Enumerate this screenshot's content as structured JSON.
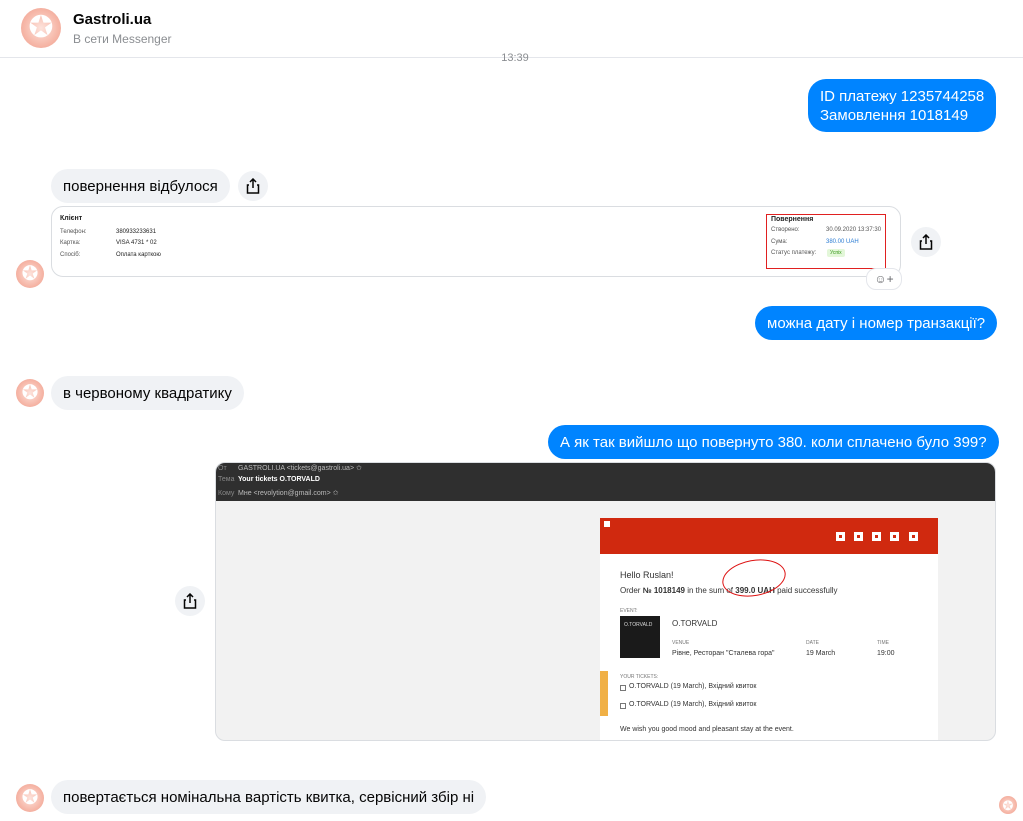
{
  "header": {
    "title": "Gastroli.ua",
    "subtitle": "В сети Messenger"
  },
  "timestamp": "13:39",
  "messages": {
    "m1_line1": "ID платежу 1235744258",
    "m1_line2": "Замовлення 1018149",
    "m2": "повернення відбулося",
    "m3": "можна дату і номер транзакції?",
    "m4": "в червоному квадратику",
    "m5": "А як так вийшло що повернуто 380. коли сплачено було 399?",
    "m6": "повертається номінальна вартість квитка, сервісний збір ні"
  },
  "payment_card": {
    "client_title": "Клієнт",
    "phone_label": "Телефон:",
    "phone_value": "380933233631",
    "card_label": "Картка:",
    "card_value": "VISA 4731 * 02",
    "method_label": "Спосіб:",
    "method_value": "Оплата карткою",
    "refund_title": "Повернення",
    "created_label": "Створено:",
    "created_value": "30.09.2020 13:37:30",
    "sum_label": "Сума:",
    "sum_value": "380.00 UAH",
    "status_label": "Статус платежу:",
    "status_value": "Успіх"
  },
  "email": {
    "from_label": "От",
    "from_value": "GASTROLI.UA <tickets@gastroli.ua> ✩",
    "subject_label": "Тема",
    "subject_value": "Your tickets O.TORVALD",
    "to_label": "Кому",
    "to_value": "Мне <revolytion@gmail.com> ✩",
    "greeting": "Hello Ruslan!",
    "order_prefix": "Order",
    "order_no": "№ 1018149",
    "order_mid": "in the sum of",
    "order_sum": "399.0 UAH",
    "order_suffix": "paid successfully",
    "event_label": "EVENT:",
    "event_name": "O.TORVALD",
    "poster_text": "O.TORVALD",
    "venue_label": "VENUE",
    "venue_value": "Рівне, Ресторан \"Сталева гора\"",
    "date_label": "DATE",
    "date_value": "19 March",
    "time_label": "TIME",
    "time_value": "19:00",
    "tickets_label": "YOUR TICKETS:",
    "ticket1": "O.TORVALD (19 March), Вхідний квиток",
    "ticket2": "O.TORVALD (19 March), Вхідний квиток",
    "wish": "We wish you good mood and pleasant stay at the event."
  },
  "colors": {
    "outgoing": "#0084ff",
    "incoming": "#f0f2f5",
    "highlight_red": "#e02020",
    "email_red": "#d0290f"
  }
}
